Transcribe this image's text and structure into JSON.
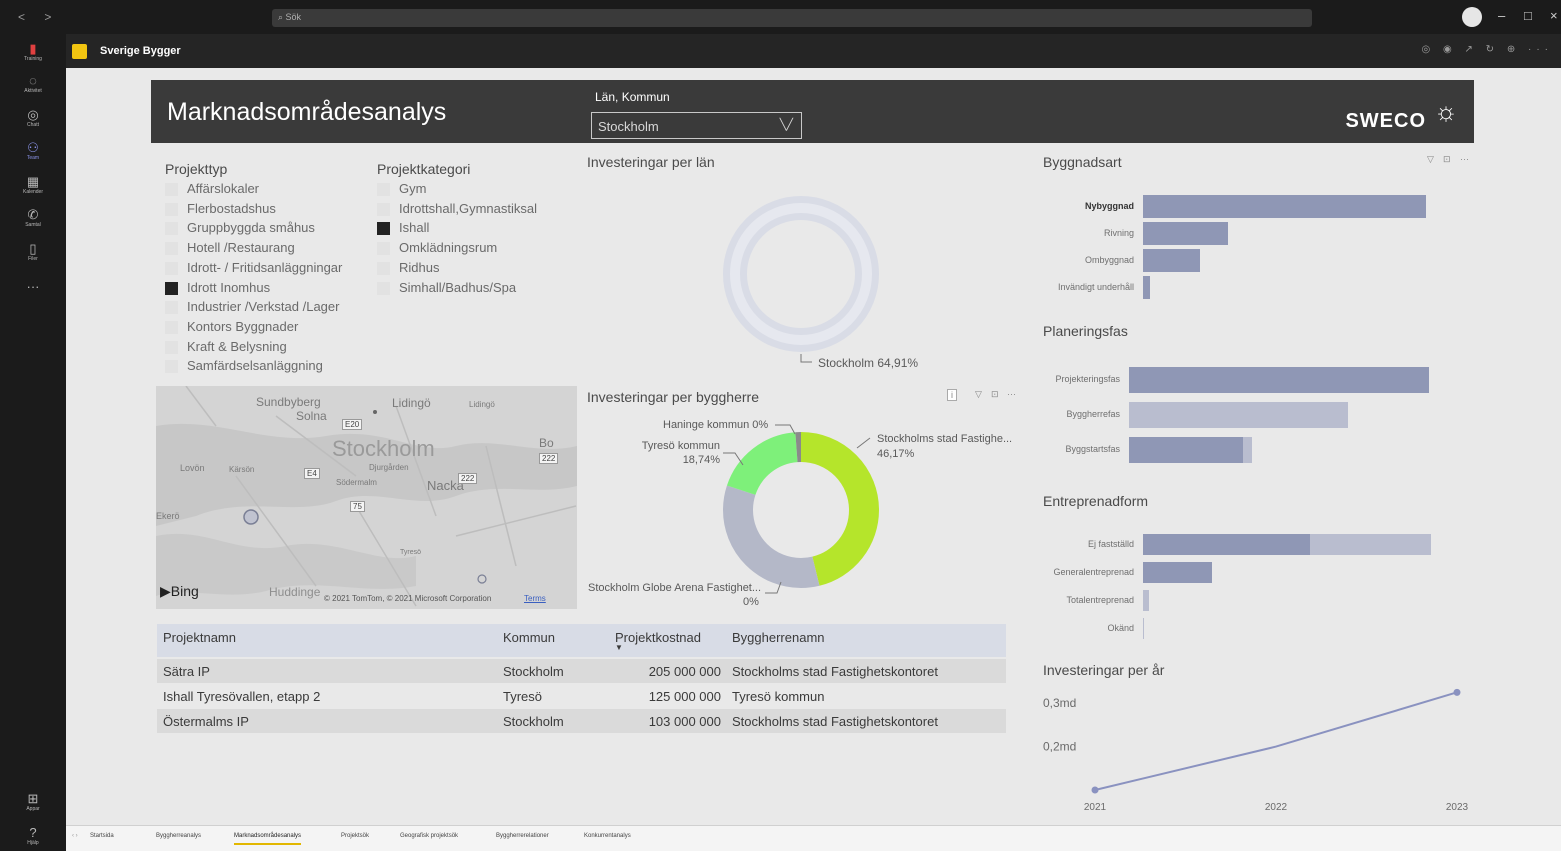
{
  "window": {
    "search_placeholder": "Sök",
    "nav": "< >",
    "buttons": [
      "–",
      "□",
      "×"
    ]
  },
  "rail": [
    {
      "label": "Training",
      "icon": "training-icon"
    },
    {
      "label": "Aktivitet",
      "icon": "bell-icon"
    },
    {
      "label": "Chatt",
      "icon": "chat-icon"
    },
    {
      "label": "Team",
      "icon": "teams-icon"
    },
    {
      "label": "Kalender",
      "icon": "calendar-icon"
    },
    {
      "label": "Samtal",
      "icon": "phone-icon"
    },
    {
      "label": "Filer",
      "icon": "file-icon"
    },
    {
      "label": "Appar",
      "icon": "apps-icon"
    },
    {
      "label": "Hjälp",
      "icon": "help-icon"
    }
  ],
  "app": {
    "name": "Sverige Bygger"
  },
  "banner": {
    "title": "Marknadsområdesanalys",
    "slicer_label": "Län, Kommun",
    "slicer_value": "Stockholm",
    "brand": "SWECO"
  },
  "projekttyp": {
    "title": "Projekttyp",
    "items": [
      {
        "label": "Affärslokaler",
        "checked": false
      },
      {
        "label": "Flerbostadshus",
        "checked": false
      },
      {
        "label": "Gruppbyggda småhus",
        "checked": false
      },
      {
        "label": "Hotell /Restaurang",
        "checked": false
      },
      {
        "label": "Idrott- / Fritidsanläggningar",
        "checked": false
      },
      {
        "label": "Idrott Inomhus",
        "checked": true
      },
      {
        "label": "Industrier /Verkstad /Lager",
        "checked": false
      },
      {
        "label": "Kontors Byggnader",
        "checked": false
      },
      {
        "label": "Kraft & Belysning",
        "checked": false
      },
      {
        "label": "Samfärdselsanläggning",
        "checked": false
      }
    ]
  },
  "projektkategori": {
    "title": "Projektkategori",
    "items": [
      {
        "label": "Gym",
        "checked": false
      },
      {
        "label": "Idrottshall,Gymnastiksal",
        "checked": false
      },
      {
        "label": "Ishall",
        "checked": true
      },
      {
        "label": "Omklädningsrum",
        "checked": false
      },
      {
        "label": "Ridhus",
        "checked": false
      },
      {
        "label": "Simhall/Badhus/Spa",
        "checked": false
      }
    ]
  },
  "map": {
    "places": [
      "Sundbyberg",
      "Solna",
      "Lidingö",
      "Lidingö",
      "Stockholm",
      "Bo",
      "Lovön",
      "Kärsön",
      "Djurgården",
      "Södermalm",
      "Nacka",
      "Ekerö",
      "Huddinge",
      "Tyresö"
    ],
    "roads": [
      "E20",
      "222",
      "E4",
      "222",
      "75"
    ],
    "attribution": "© 2021 TomTom, © 2021 Microsoft Corporation",
    "terms": "Terms",
    "provider": "Bing"
  },
  "chart_data": [
    {
      "type": "pie",
      "title": "Investeringar per län",
      "slices": [
        {
          "label": "Stockholm",
          "value": 64.91,
          "display": "Stockholm 64,91%"
        }
      ]
    },
    {
      "type": "pie",
      "title": "Investeringar per byggherre",
      "slices": [
        {
          "label": "Stockholms stad Fastighe...",
          "value": 46.17,
          "display": "46,17%",
          "color": "#b5e52b"
        },
        {
          "label": "Stockholm Globe Arena Fastighet...",
          "value": 0,
          "display": "0%",
          "color": "#b4b8c8"
        },
        {
          "label": "Tyresö kommun",
          "value": 18.74,
          "display": "18,74%",
          "color": "#7ef07a"
        },
        {
          "label": "Haninge kommun",
          "value": 0,
          "display": "0%",
          "color": "#8a8a8a"
        }
      ],
      "remainder_color": "#b4b8c8"
    },
    {
      "type": "bar",
      "title": "Byggnadsart",
      "categories": [
        "Nybyggnad",
        "Rivning",
        "Ombyggnad",
        "Invändigt underhåll"
      ],
      "values": [
        100,
        30,
        20,
        2.5
      ],
      "xlim": [
        0,
        100
      ]
    },
    {
      "type": "bar",
      "title": "Planeringsfas",
      "categories": [
        "Projekteringsfas",
        "Byggherrefas",
        "Byggstartsfas"
      ],
      "values": [
        100,
        73,
        41
      ],
      "highlighted": [
        100,
        0,
        38
      ],
      "xlim": [
        0,
        100
      ]
    },
    {
      "type": "bar",
      "title": "Entreprenadform",
      "categories": [
        "Ej fastställd",
        "Generalentreprenad",
        "Totalentreprenad",
        "Okänd"
      ],
      "values": [
        100,
        24,
        2,
        0
      ],
      "highlighted": [
        58,
        24,
        0,
        0
      ],
      "xlim": [
        0,
        100
      ]
    },
    {
      "type": "line",
      "title": "Investeringar per år",
      "x": [
        "2021",
        "2022",
        "2023"
      ],
      "y": [
        0.1,
        0.2,
        0.325
      ],
      "y_ticks": [
        "0,3md",
        "0,2md"
      ],
      "ylim": [
        0.1,
        0.335
      ]
    }
  ],
  "table": {
    "columns": [
      "Projektnamn",
      "Kommun",
      "Projektkostnad",
      "Byggherrenamn"
    ],
    "rows": [
      [
        "Sätra IP",
        "Stockholm",
        "205 000 000",
        "Stockholms stad Fastighetskontoret"
      ],
      [
        "Ishall Tyresövallen, etapp 2",
        "Tyresö",
        "125 000 000",
        "Tyresö kommun"
      ],
      [
        "Östermalms IP",
        "Stockholm",
        "103 000 000",
        "Stockholms stad Fastighetskontoret"
      ]
    ]
  },
  "tabs": [
    {
      "label": "Startsida",
      "active": false
    },
    {
      "label": "Byggherreanalys",
      "active": false
    },
    {
      "label": "Marknadsområdesanalys",
      "active": true
    },
    {
      "label": "Projektsök",
      "active": false
    },
    {
      "label": "Geografisk projektsök",
      "active": false
    },
    {
      "label": "Byggherrerelationer",
      "active": false
    },
    {
      "label": "Konkurrentanalys",
      "active": false
    }
  ],
  "colors": {
    "bar": "#8f97b5",
    "bar_light": "#b9bdcf",
    "line": "#8a92c0",
    "accent_green": "#b5e52b"
  }
}
